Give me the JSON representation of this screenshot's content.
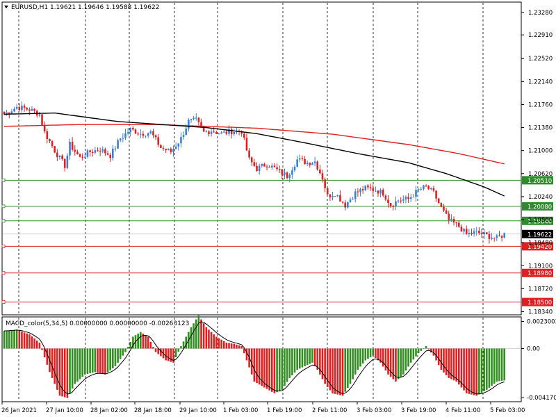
{
  "chart_data": {
    "type": "candlestick",
    "symbol_header": "EURUSD,H1  1.19621 1.19646 1.19588 1.19622",
    "current_price": "1.19622",
    "price_ticks": [
      "1.23280",
      "1.22910",
      "1.22520",
      "1.22140",
      "1.21760",
      "1.21380",
      "1.21000",
      "1.20620",
      "1.20240",
      "1.19860",
      "1.19480",
      "1.19100",
      "1.18720",
      "1.18340"
    ],
    "price_range": [
      1.183,
      1.2344
    ],
    "x_labels": [
      "26 Jan 2021",
      "27 Jan 10:00",
      "28 Jan 02:00",
      "28 Jan 18:00",
      "29 Jan 10:00",
      "1 Feb 03:00",
      "1 Feb 19:00",
      "2 Feb 11:00",
      "3 Feb 03:00",
      "3 Feb 19:00",
      "4 Feb 11:00",
      "5 Feb 03:00"
    ],
    "levels": [
      {
        "value": "1.20510",
        "price": 1.2051,
        "color": "#2e8b2e"
      },
      {
        "value": "1.20080",
        "price": 1.2008,
        "color": "#2e8b2e"
      },
      {
        "value": "1.19840",
        "price": 1.1984,
        "color": "#2e8b2e"
      },
      {
        "value": "1.19420",
        "price": 1.1942,
        "color": "#e02020"
      },
      {
        "value": "1.18980",
        "price": 1.1898,
        "color": "#e02020"
      },
      {
        "value": "1.18500",
        "price": 1.185,
        "color": "#e02020"
      }
    ],
    "close_anchors": [
      [
        0,
        1.216
      ],
      [
        5,
        1.2172
      ],
      [
        10,
        1.2168
      ],
      [
        14,
        1.216
      ],
      [
        16,
        1.213
      ],
      [
        20,
        1.21
      ],
      [
        24,
        1.2075
      ],
      [
        26,
        1.211
      ],
      [
        30,
        1.2088
      ],
      [
        34,
        1.2098
      ],
      [
        38,
        1.2102
      ],
      [
        42,
        1.2092
      ],
      [
        46,
        1.212
      ],
      [
        50,
        1.2135
      ],
      [
        54,
        1.2128
      ],
      [
        58,
        1.213
      ],
      [
        62,
        1.2105
      ],
      [
        66,
        1.2098
      ],
      [
        70,
        1.212
      ],
      [
        73,
        1.2148
      ],
      [
        76,
        1.215
      ],
      [
        79,
        1.213
      ],
      [
        82,
        1.2133
      ],
      [
        86,
        1.2128
      ],
      [
        90,
        1.2132
      ],
      [
        94,
        1.2132
      ],
      [
        97,
        1.2085
      ],
      [
        100,
        1.207
      ],
      [
        104,
        1.2078
      ],
      [
        108,
        1.2068
      ],
      [
        112,
        1.2058
      ],
      [
        116,
        1.2085
      ],
      [
        120,
        1.208
      ],
      [
        123,
        1.2082
      ],
      [
        126,
        1.2055
      ],
      [
        128,
        1.2025
      ],
      [
        131,
        1.203
      ],
      [
        135,
        1.201
      ],
      [
        139,
        1.203
      ],
      [
        143,
        1.2038
      ],
      [
        147,
        1.2035
      ],
      [
        150,
        1.203
      ],
      [
        153,
        1.201
      ],
      [
        156,
        1.2018
      ],
      [
        160,
        1.202
      ],
      [
        164,
        1.2035
      ],
      [
        167,
        1.204
      ],
      [
        170,
        1.203
      ],
      [
        173,
        1.2005
      ],
      [
        176,
        1.1985
      ],
      [
        180,
        1.1975
      ],
      [
        183,
        1.1962
      ],
      [
        187,
        1.1965
      ],
      [
        191,
        1.196
      ],
      [
        195,
        1.1955
      ],
      [
        198,
        1.1962
      ]
    ],
    "ma_black": [
      [
        0,
        1.216
      ],
      [
        20,
        1.2162
      ],
      [
        45,
        1.2148
      ],
      [
        80,
        1.2138
      ],
      [
        100,
        1.2128
      ],
      [
        120,
        1.2112
      ],
      [
        140,
        1.2095
      ],
      [
        160,
        1.208
      ],
      [
        175,
        1.2062
      ],
      [
        190,
        1.204
      ],
      [
        198,
        1.2025
      ]
    ],
    "ma_red": [
      [
        0,
        1.214
      ],
      [
        30,
        1.2143
      ],
      [
        60,
        1.2143
      ],
      [
        100,
        1.2137
      ],
      [
        130,
        1.2127
      ],
      [
        160,
        1.211
      ],
      [
        180,
        1.2095
      ],
      [
        198,
        1.2078
      ]
    ],
    "macd": {
      "label": "MACD_color(5,34,5) 0.00000000 0.00000000 -0.00263123",
      "ticks": [
        "0.0023003",
        "0.00",
        "-0.004170"
      ],
      "range": [
        -0.00445,
        0.00262
      ],
      "hist_anchors": [
        [
          0,
          0.0015
        ],
        [
          5,
          0.0016
        ],
        [
          10,
          0.0012
        ],
        [
          14,
          0.0005
        ],
        [
          18,
          -0.002
        ],
        [
          22,
          -0.004
        ],
        [
          25,
          -0.0042
        ],
        [
          28,
          -0.003
        ],
        [
          32,
          -0.0022
        ],
        [
          36,
          -0.002
        ],
        [
          40,
          -0.0022
        ],
        [
          44,
          -0.0015
        ],
        [
          48,
          -0.0003
        ],
        [
          51,
          0.001
        ],
        [
          54,
          0.0014
        ],
        [
          57,
          0.001
        ],
        [
          60,
          -0.0003
        ],
        [
          64,
          -0.001
        ],
        [
          67,
          -0.0012
        ],
        [
          70,
          0.0002
        ],
        [
          74,
          0.0018
        ],
        [
          77,
          0.0028
        ],
        [
          80,
          0.0018
        ],
        [
          84,
          0.001
        ],
        [
          88,
          0.0005
        ],
        [
          91,
          0.0004
        ],
        [
          94,
          0.0002
        ],
        [
          96,
          -0.001
        ],
        [
          99,
          -0.0028
        ],
        [
          103,
          -0.0033
        ],
        [
          107,
          -0.0038
        ],
        [
          110,
          -0.0035
        ],
        [
          113,
          -0.0025
        ],
        [
          116,
          -0.0018
        ],
        [
          119,
          -0.0015
        ],
        [
          122,
          -0.0012
        ],
        [
          124,
          -0.0018
        ],
        [
          127,
          -0.003
        ],
        [
          130,
          -0.0038
        ],
        [
          134,
          -0.004
        ],
        [
          137,
          -0.003
        ],
        [
          140,
          -0.0018
        ],
        [
          143,
          -0.001
        ],
        [
          146,
          -0.0006
        ],
        [
          149,
          -0.0012
        ],
        [
          152,
          -0.0022
        ],
        [
          155,
          -0.0028
        ],
        [
          158,
          -0.0022
        ],
        [
          161,
          -0.0012
        ],
        [
          164,
          -0.0004
        ],
        [
          167,
          0.0002
        ],
        [
          170,
          -0.0006
        ],
        [
          173,
          -0.0018
        ],
        [
          176,
          -0.0025
        ],
        [
          179,
          -0.0028
        ],
        [
          183,
          -0.0038
        ],
        [
          187,
          -0.004
        ],
        [
          191,
          -0.0035
        ],
        [
          195,
          -0.0028
        ],
        [
          198,
          -0.0027
        ]
      ]
    }
  },
  "colors": {
    "up": "#3a7fd6",
    "down": "#e02020",
    "hist_up": "#2f8f1f",
    "hist_down": "#e02020",
    "ma_black": "#000000",
    "ma_red": "#e02020",
    "current": "#000000"
  }
}
